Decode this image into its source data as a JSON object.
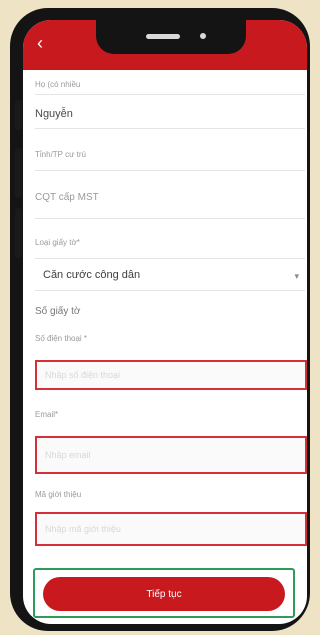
{
  "header": {
    "back_icon": "chevron-left-icon",
    "accent_color": "#c8191e"
  },
  "form": {
    "family_name_label": "Họ (có nhiều",
    "family_name_value": "Nguyễn",
    "province_label": "Tỉnh/TP cư trú",
    "tax_office_label": "CQT cấp MST",
    "id_type_label": "Loại giấy tờ*",
    "id_type_value": "Căn cước công dân",
    "id_number_title": "Số giấy tờ",
    "phone_label": "Số điện thoại *",
    "phone_placeholder": "Nhập số điện thoại",
    "email_label": "Email*",
    "email_placeholder": "Nhập email",
    "referral_label": "Mã giới thiệu",
    "referral_placeholder": "Nhập mã giới thiệu"
  },
  "footer": {
    "continue_label": "Tiếp tục",
    "highlight_color": "#2f9b5a"
  }
}
